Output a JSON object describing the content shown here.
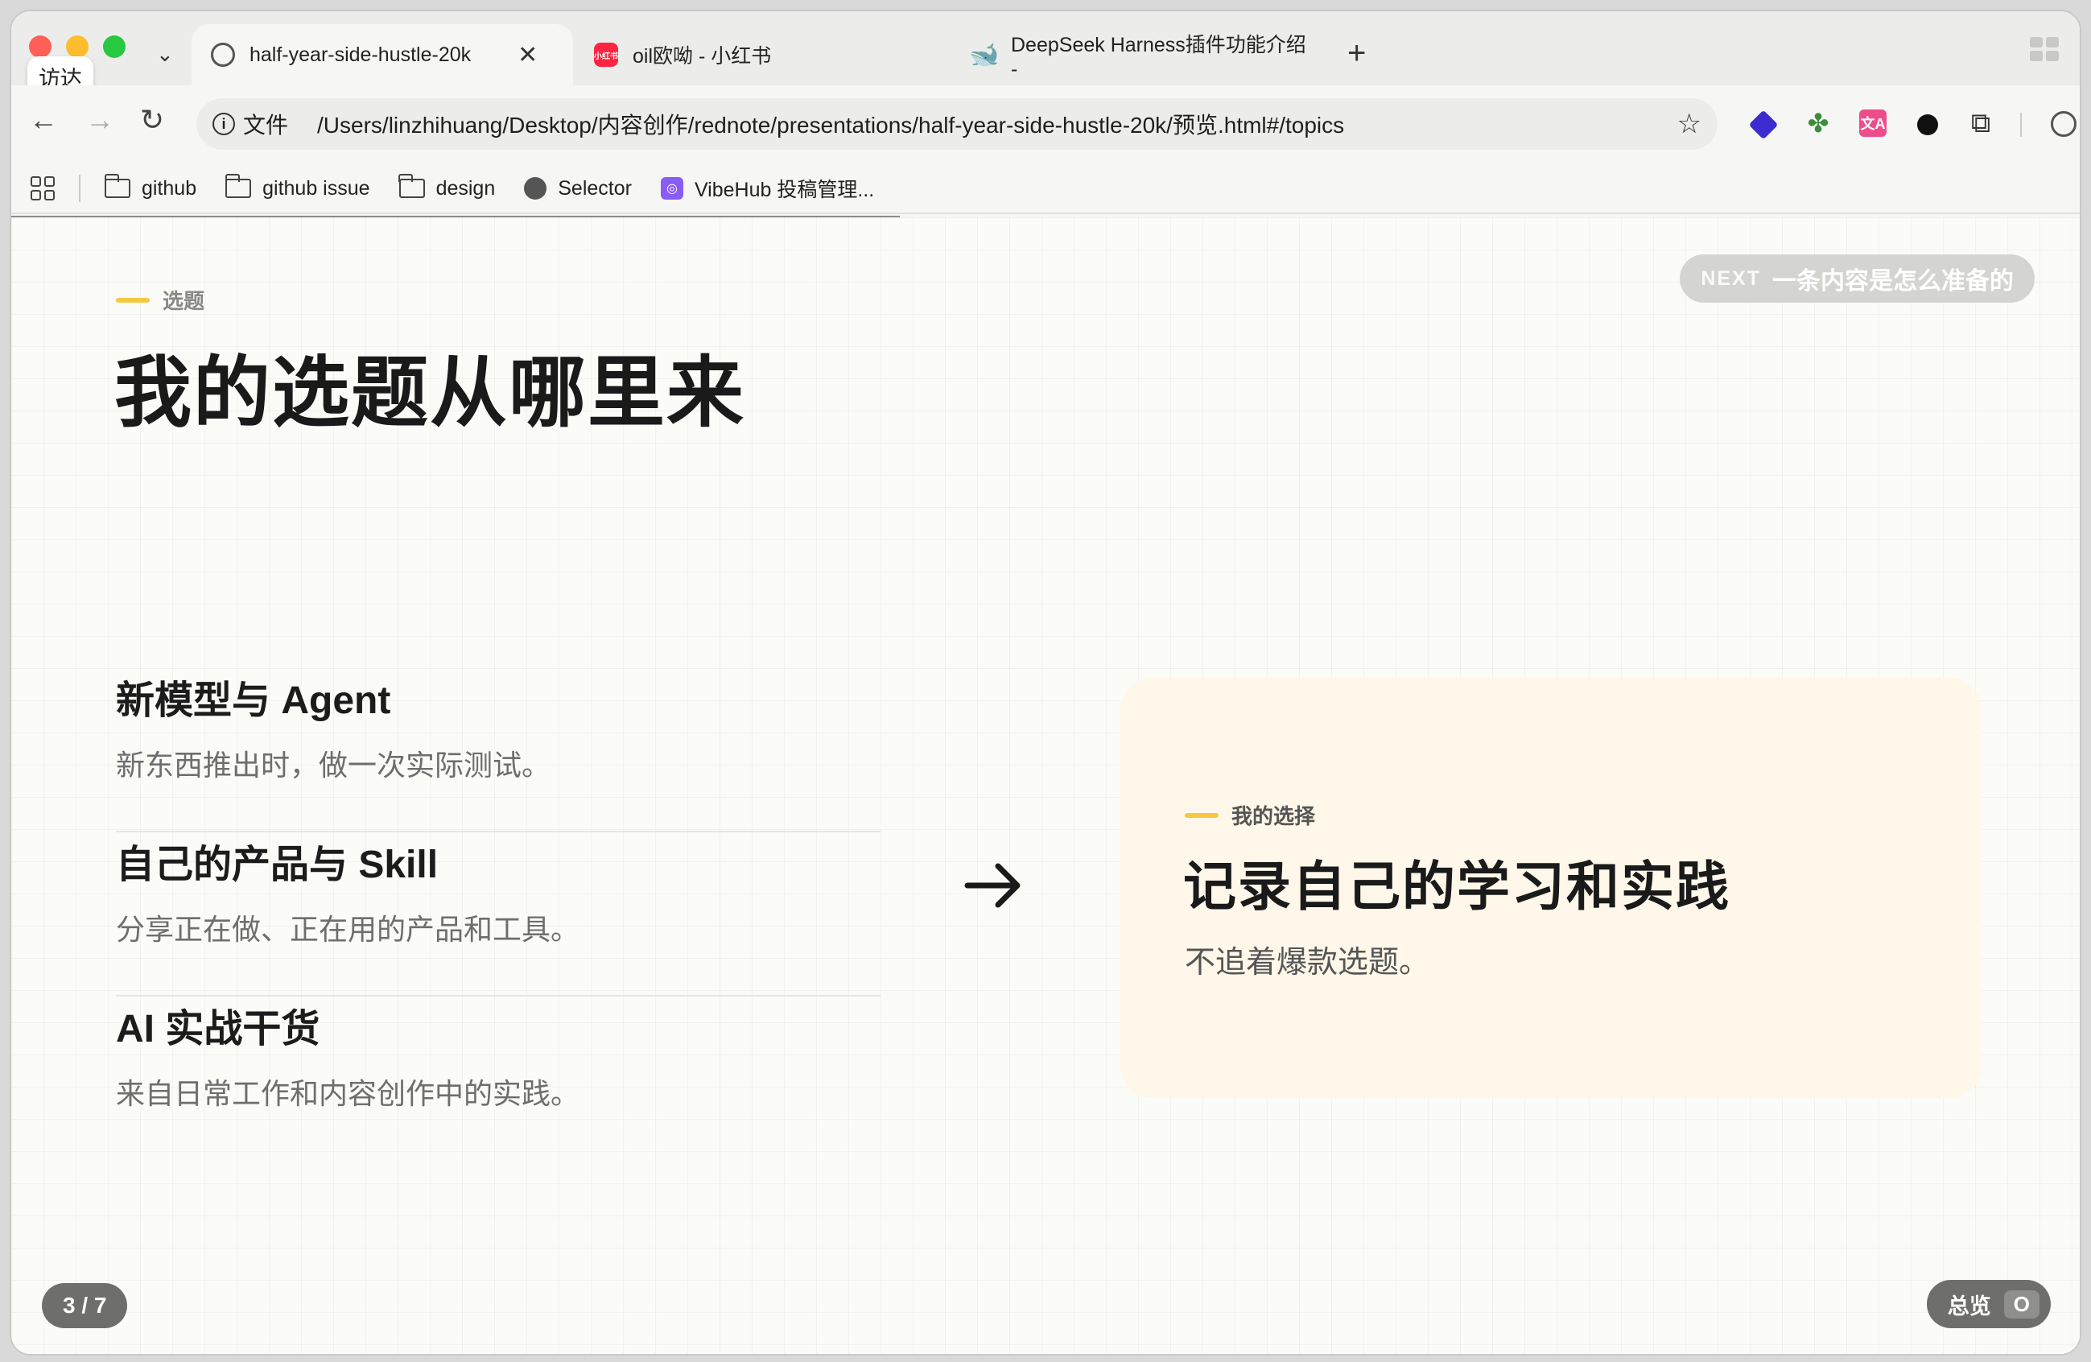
{
  "browser": {
    "tooltip": "访达",
    "tabs": [
      {
        "title": "half-year-side-hustle-20k",
        "active": true
      },
      {
        "title": "oil欧呦 - 小红书",
        "favicon_text": "小红书"
      },
      {
        "title": "DeepSeek Harness插件功能介绍 -"
      }
    ],
    "new_tab": "+",
    "tab_close": "✕",
    "tab_dropdown": "⌄",
    "address": {
      "scheme_label": "文件",
      "url": "/Users/linzhihuang/Desktop/内容创作/rednote/presentations/half-year-side-hustle-20k/预览.html#/topics"
    },
    "nav": {
      "back": "←",
      "forward": "→",
      "reload": "↻"
    },
    "extensions": {
      "pink_label": "文A"
    },
    "bookmarks": [
      {
        "label": "github",
        "icon": "folder-icon"
      },
      {
        "label": "github issue",
        "icon": "folder-icon"
      },
      {
        "label": "design",
        "icon": "folder-icon"
      },
      {
        "label": "Selector",
        "icon": "globe-icon"
      },
      {
        "label": "VibeHub 投稿管理...",
        "icon": "vibehub-icon"
      }
    ]
  },
  "slide": {
    "next_label": "NEXT",
    "next_title": "一条内容是怎么准备的",
    "kicker": "选题",
    "title": "我的选题从哪里来",
    "sources": [
      {
        "heading": "新模型与 Agent",
        "desc": "新东西推出时，做一次实际测试。"
      },
      {
        "heading": "自己的产品与 Skill",
        "desc": "分享正在做、正在用的产品和工具。"
      },
      {
        "heading": "AI 实战干货",
        "desc": "来自日常工作和内容创作中的实践。"
      }
    ],
    "choice": {
      "kicker": "我的选择",
      "headline": "记录自己的学习和实践",
      "sub": "不追着爆款选题。"
    },
    "counter": "3 / 7",
    "overview_label": "总览",
    "overview_key": "O"
  },
  "colors": {
    "accent": "#f5c842",
    "card_bg": "#fff7e9",
    "pill_bg": "#6e6e6c"
  }
}
